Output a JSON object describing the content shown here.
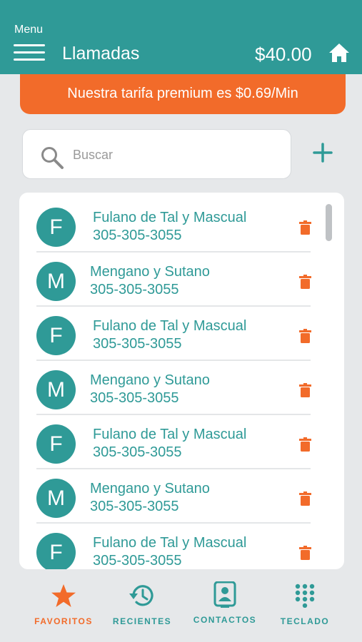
{
  "header": {
    "menu_label": "Menu",
    "title": "Llamadas",
    "balance": "$40.00"
  },
  "promo": {
    "text": "Nuestra tarifa premium es $0.69/Min"
  },
  "search": {
    "placeholder": "Buscar",
    "value": ""
  },
  "contacts": [
    {
      "initial": "F",
      "name": "Fulano de Tal y Mascual",
      "phone": "305-305-3055"
    },
    {
      "initial": "M",
      "name": "Mengano y Sutano",
      "phone": "305-305-3055"
    },
    {
      "initial": "F",
      "name": "Fulano de Tal y Mascual",
      "phone": "305-305-3055"
    },
    {
      "initial": "M",
      "name": "Mengano y Sutano",
      "phone": "305-305-3055"
    },
    {
      "initial": "F",
      "name": "Fulano de Tal y Mascual",
      "phone": "305-305-3055"
    },
    {
      "initial": "M",
      "name": "Mengano y Sutano",
      "phone": "305-305-3055"
    },
    {
      "initial": "F",
      "name": "Fulano de Tal y Mascual",
      "phone": "305-305-3055"
    }
  ],
  "tabs": [
    {
      "label": "FAVORITOS",
      "icon": "star-icon",
      "active": true
    },
    {
      "label": "RECIENTES",
      "icon": "history-icon",
      "active": false
    },
    {
      "label": "CONTACTOS",
      "icon": "contact-card-icon",
      "active": false
    },
    {
      "label": "TECLADO",
      "icon": "keypad-icon",
      "active": false
    }
  ],
  "colors": {
    "primary": "#2f9a97",
    "accent": "#f26b2a",
    "background": "#e6e8ea"
  }
}
